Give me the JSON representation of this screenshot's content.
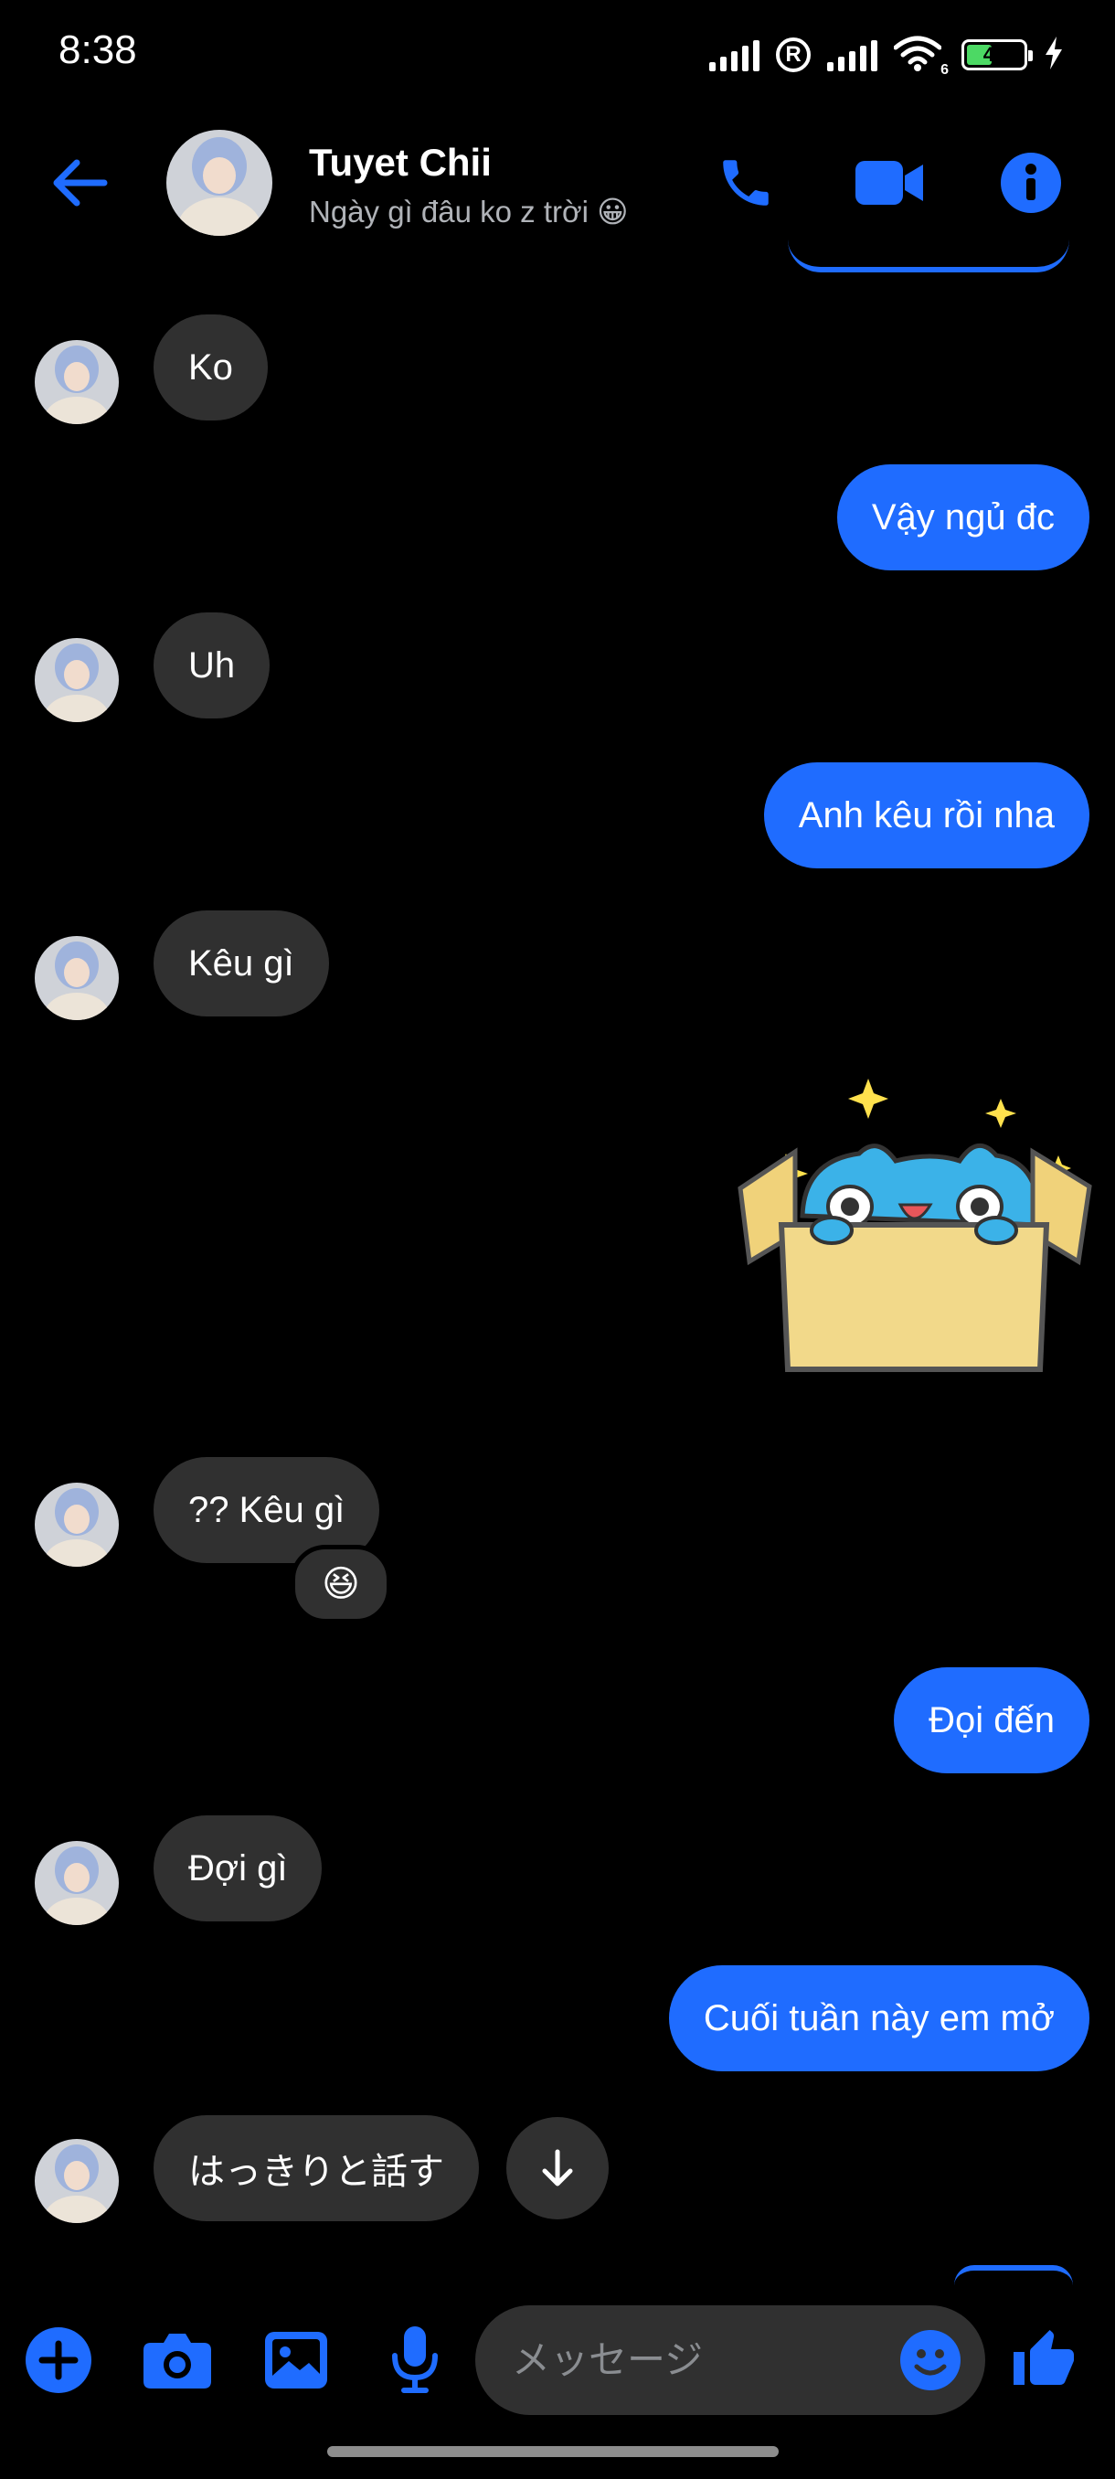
{
  "status_bar": {
    "time": "8:38",
    "battery_level": "45",
    "wifi_badge": "6"
  },
  "header": {
    "contact_name": "Tuyet Chii",
    "contact_status": "Ngày gì đâu ko z trời 😀",
    "icons": [
      "back-arrow-icon",
      "phone-icon",
      "video-camera-icon",
      "info-icon"
    ]
  },
  "colors": {
    "accent": "#1f6cff",
    "incoming_bubble": "#303030",
    "background": "#000000"
  },
  "messages": [
    {
      "sender": "contact",
      "text": "Ko"
    },
    {
      "sender": "me",
      "text": "Vậy ngủ đc"
    },
    {
      "sender": "contact",
      "text": "Uh"
    },
    {
      "sender": "me",
      "text": "Anh kêu rồi nha"
    },
    {
      "sender": "contact",
      "text": "Kêu gì"
    },
    {
      "sender": "me",
      "type": "sticker",
      "sticker": "blue-cat-in-box-sticker"
    },
    {
      "sender": "contact",
      "text": "?? Kêu gì",
      "reaction": "😆"
    },
    {
      "sender": "me",
      "text": "Đọi đến"
    },
    {
      "sender": "contact",
      "text": "Đợi gì"
    },
    {
      "sender": "me",
      "text": "Cuối tuần này em mở"
    },
    {
      "sender": "contact",
      "text": "はっきりと話す"
    }
  ],
  "composer": {
    "placeholder": "メッセージ",
    "icons": [
      "plus-icon",
      "camera-icon",
      "gallery-icon",
      "microphone-icon",
      "emoji-icon",
      "thumbs-up-icon"
    ]
  }
}
